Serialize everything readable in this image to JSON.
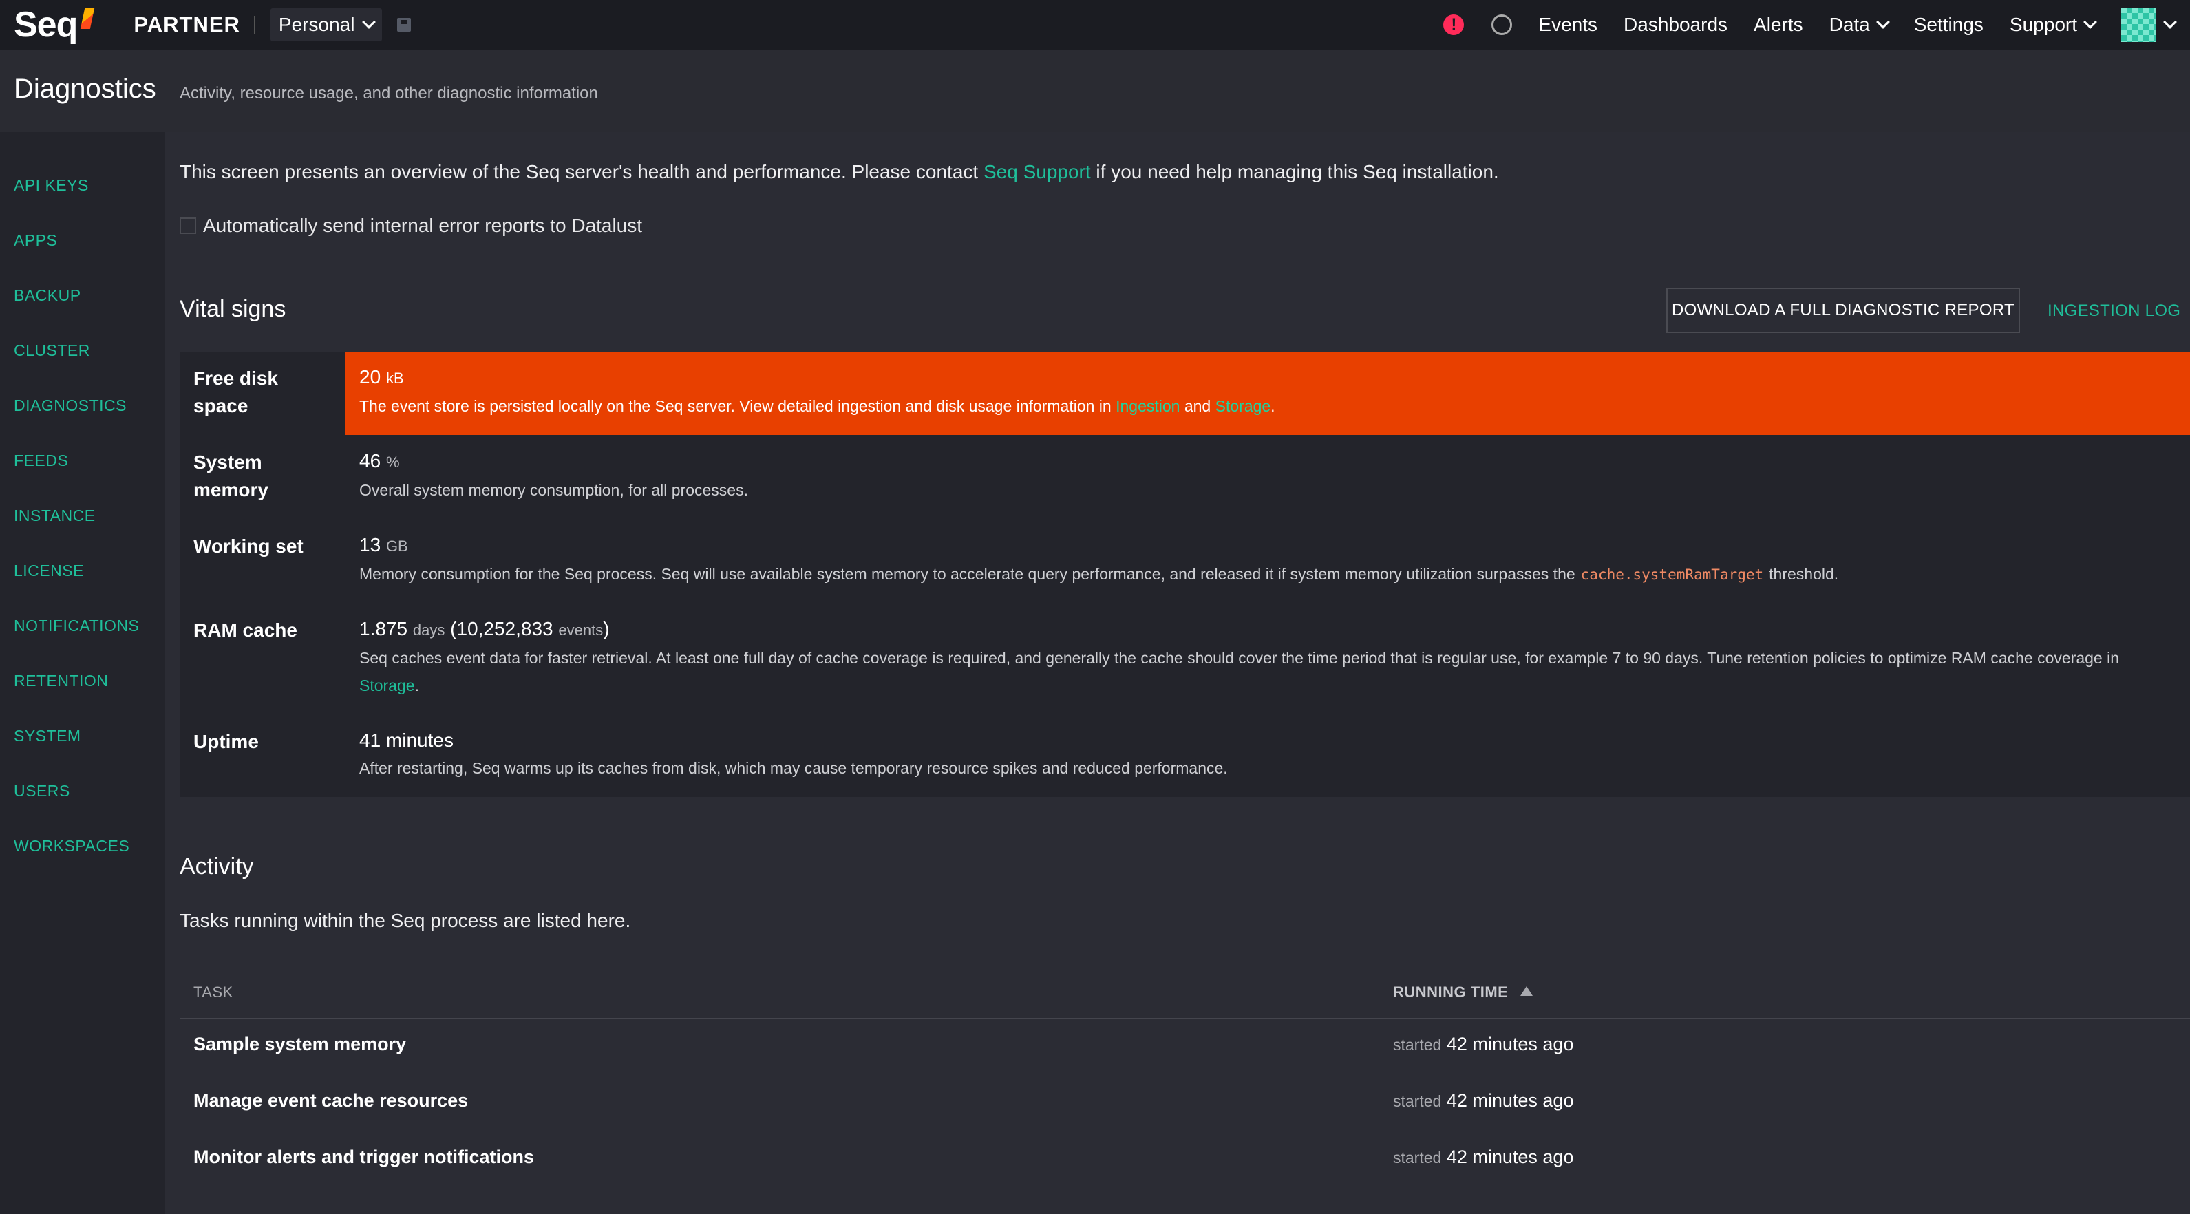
{
  "topbar": {
    "logo": "Seq",
    "edition": "PARTNER",
    "workspace": "Personal",
    "nav": [
      "Events",
      "Dashboards",
      "Alerts",
      "Data",
      "Settings",
      "Support"
    ],
    "alert_glyph": "!"
  },
  "header": {
    "title": "Diagnostics",
    "subtitle": "Activity, resource usage, and other diagnostic information"
  },
  "sidebar": {
    "items": [
      "API KEYS",
      "APPS",
      "BACKUP",
      "CLUSTER",
      "DIAGNOSTICS",
      "FEEDS",
      "INSTANCE",
      "LICENSE",
      "NOTIFICATIONS",
      "RETENTION",
      "SYSTEM",
      "USERS",
      "WORKSPACES"
    ]
  },
  "intro": {
    "before": "This screen presents an overview of the Seq server's health and performance. Please contact ",
    "link": "Seq Support",
    "after": " if you need help managing this Seq installation."
  },
  "auto_report": {
    "label": "Automatically send internal error reports to Datalust",
    "checked": false
  },
  "vitals": {
    "title": "Vital signs",
    "download_button": "DOWNLOAD A FULL DIAGNOSTIC REPORT",
    "ingestion_log": "INGESTION LOG",
    "disk": {
      "label": "Free disk space",
      "value": "20",
      "unit": "kB",
      "desc_before": "The event store is persisted locally on the Seq server. View detailed ingestion and disk usage information in ",
      "link1": "Ingestion",
      "mid": " and ",
      "link2": "Storage",
      "end": "."
    },
    "memory": {
      "label": "System memory",
      "value": "46",
      "unit": "%",
      "desc": "Overall system memory consumption, for all processes."
    },
    "working_set": {
      "label": "Working set",
      "value": "13",
      "unit": "GB",
      "desc_before": "Memory consumption for the Seq process. Seq will use available system memory to accelerate query performance, and released it if system memory utilization surpasses the",
      "code": "cache.systemRamTarget",
      "desc_after": "threshold."
    },
    "ram_cache": {
      "label": "RAM cache",
      "value": "1.875",
      "unit": "days",
      "events_open": "(10,252,833",
      "events_unit": "events",
      "events_close": ")",
      "desc": "Seq caches event data for faster retrieval. At least one full day of cache coverage is required, and generally the cache should cover the time period that is regular use, for example 7 to 90 days. Tune retention policies to optimize RAM cache coverage in ",
      "link": "Storage",
      "end": "."
    },
    "uptime": {
      "label": "Uptime",
      "value": "41 minutes",
      "desc": "After restarting, Seq warms up its caches from disk, which may cause temporary resource spikes and reduced performance."
    }
  },
  "activity": {
    "title": "Activity",
    "intro": "Tasks running within the Seq process are listed here.",
    "col_task": "TASK",
    "col_running": "RUNNING TIME",
    "started_word": "started",
    "rows": [
      {
        "task": "Sample system memory",
        "time": "42 minutes ago"
      },
      {
        "task": "Manage event cache resources",
        "time": "42 minutes ago"
      },
      {
        "task": "Monitor alerts and trigger notifications",
        "time": "42 minutes ago"
      }
    ]
  },
  "colors": {
    "accent": "#1fbf9a",
    "danger": "#e84000",
    "alert": "#ff2b59",
    "background": "#2b2c34",
    "panel": "#23242b"
  }
}
